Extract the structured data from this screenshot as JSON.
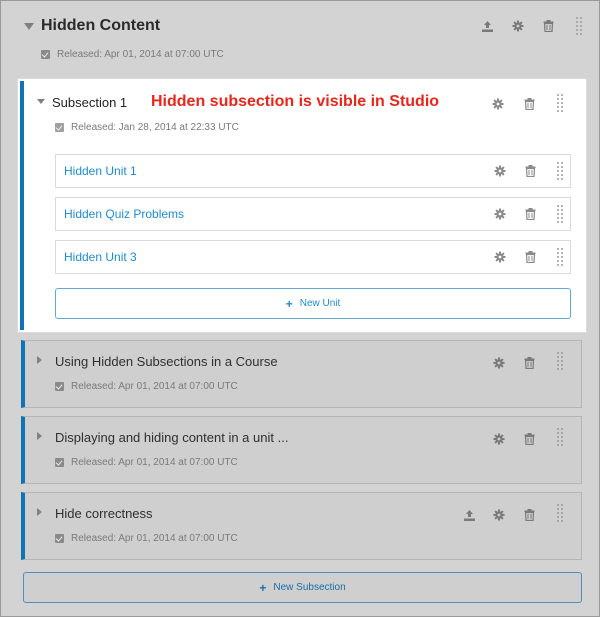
{
  "section": {
    "title": "Hidden Content",
    "release": "Released: Apr 01, 2014 at 07:00 UTC"
  },
  "annotation": "Hidden subsection is visible in Studio",
  "highlighted_subsection": {
    "title": "Subsection 1",
    "release": "Released: Jan 28, 2014 at 22:33 UTC",
    "units": [
      {
        "title": "Hidden Unit 1"
      },
      {
        "title": "Hidden Quiz Problems"
      },
      {
        "title": "Hidden Unit 3"
      }
    ],
    "new_unit_label": "New Unit"
  },
  "subsections": [
    {
      "title": "Using Hidden Subsections in a Course",
      "release": "Released: Apr 01, 2014 at 07:00 UTC"
    },
    {
      "title": "Displaying and hiding content in a unit ...",
      "release": "Released: Apr 01, 2014 at 07:00 UTC"
    },
    {
      "title": "Hide correctness",
      "release": "Released: Apr 01, 2014 at 07:00 UTC"
    }
  ],
  "new_subsection_label": "New Subsection",
  "plus_glyph": "+",
  "colors": {
    "accent": "#0f74b6",
    "link": "#1f8ccc",
    "annotation": "#e8261a",
    "overlay": "#d3d3d3"
  },
  "icons": [
    "collapse-arrow-icon",
    "expand-arrow-icon",
    "checkbox-checked-icon",
    "publish-icon",
    "gear-icon",
    "trash-icon",
    "drag-handle-icon",
    "plus-icon"
  ]
}
